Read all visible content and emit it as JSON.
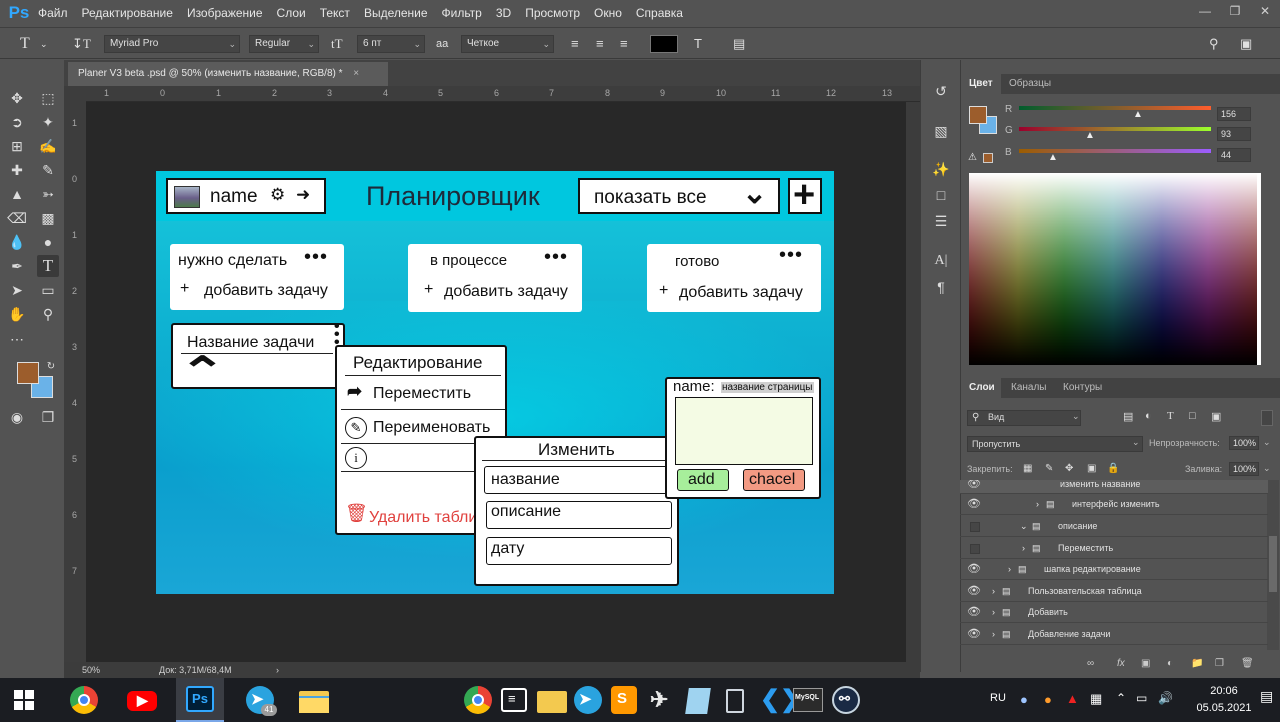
{
  "menu": {
    "logo": "Ps",
    "items": [
      "Файл",
      "Редактирование",
      "Изображение",
      "Слои",
      "Текст",
      "Выделение",
      "Фильтр",
      "3D",
      "Просмотр",
      "Окно",
      "Справка"
    ]
  },
  "options": {
    "font_family": "Myriad Pro",
    "font_style": "Regular",
    "font_size": "6 пт",
    "antialias": "Четкое"
  },
  "document": {
    "tab_title": "Planer V3 beta .psd @ 50% (изменить название, RGB/8) *",
    "ruler_top": [
      "1",
      "0",
      "1",
      "2",
      "3",
      "4",
      "5",
      "6",
      "7",
      "8",
      "9",
      "10",
      "11",
      "12",
      "13"
    ],
    "ruler_left": [
      "1",
      "0",
      "1",
      "2",
      "3",
      "4",
      "5",
      "6",
      "7"
    ],
    "zoom": "50%",
    "doc_size": "Док: 3,71M/68,4M"
  },
  "app": {
    "header_name": "name",
    "header_title": "Планировщик",
    "filter_label": "показать все",
    "columns": [
      {
        "title": "нужно сделать",
        "add": "добавить задачу"
      },
      {
        "title": "в процессе",
        "add": "добавить задачу"
      },
      {
        "title": "готово",
        "add": "добавить задачу"
      }
    ],
    "task_title": "Название задачи",
    "edit_menu": {
      "title": "Редактирование",
      "move": "Переместить",
      "rename": "Переименовать",
      "delete": "Удалить табли"
    },
    "change_menu": {
      "title": "Изменить",
      "field_name": "название",
      "field_desc": "описание",
      "field_date": "дату"
    },
    "rename_dialog": {
      "label": "name:",
      "placeholder": "название страницы",
      "add": "add",
      "cancel": "chacel"
    }
  },
  "color_panel": {
    "tabs": [
      "Цвет",
      "Образцы"
    ],
    "r_label": "R",
    "g_label": "G",
    "b_label": "B",
    "r": "156",
    "g": "93",
    "b": "44",
    "foreground": "#9c5d2c",
    "background": "#6ab2e8"
  },
  "layers_panel": {
    "tabs": [
      "Слои",
      "Каналы",
      "Контуры"
    ],
    "filter": "Вид",
    "blend": "Пропустить",
    "opacity_label": "Непрозрачность:",
    "opacity": "100%",
    "lock_label": "Закрепить:",
    "fill_label": "Заливка:",
    "fill": "100%",
    "layers": [
      {
        "name": "изменить название",
        "visible": true
      },
      {
        "name": "интерфейс изменить",
        "visible": true
      },
      {
        "name": "описание",
        "visible": false
      },
      {
        "name": "Переместить",
        "visible": false
      },
      {
        "name": "шапка редактирование",
        "visible": true
      },
      {
        "name": "Пользовательская таблица",
        "visible": true
      },
      {
        "name": "Добавить",
        "visible": true
      },
      {
        "name": "Добавление задачи",
        "visible": true
      }
    ]
  },
  "taskbar": {
    "lang": "RU",
    "time": "20:06",
    "date": "05.05.2021",
    "telegram_badge": "41"
  }
}
